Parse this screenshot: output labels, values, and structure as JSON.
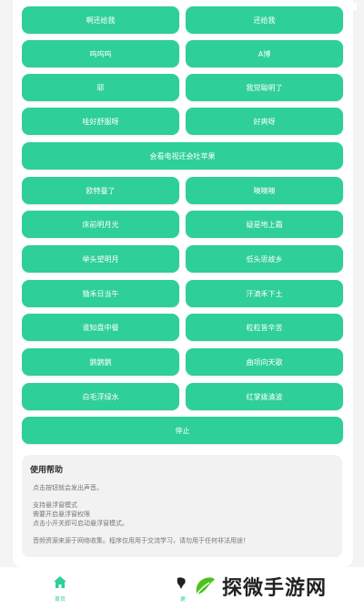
{
  "colors": {
    "accent": "#2ecf98",
    "panel": "#ffffff",
    "background": "#f4f4f4"
  },
  "status_bar": {
    "icons": [
      "signal-icon",
      "battery-icon"
    ]
  },
  "buttons": [
    "啊还给我",
    "还给我",
    "呜呜呜",
    "A博",
    "耶",
    "我觉聪明了",
    "哇好舒服呀",
    "好爽呀",
    "会看电视还会吐苹果",
    "欧特曼了",
    "噢噢噢",
    "床前明月光",
    "疑是地上霜",
    "举头望明月",
    "低头思故乡",
    "锄禾日当午",
    "汗滴禾下土",
    "谁知盘中餐",
    "粒粒皆辛苦",
    "鹅鹅鹅",
    "曲项向天歌",
    "白毛浮绿水",
    "红掌拨清波",
    "停止"
  ],
  "help": {
    "title": "使用帮助",
    "lines": [
      "点击按钮就会发出声音。",
      "支持悬浮窗模式",
      "需要开启悬浮窗权限",
      "点击小开关即可启动悬浮窗模式。",
      "音频资源来源于网络收集。程序仅用用于交流学习，请勿用于任何非法用途！"
    ]
  },
  "nav": {
    "home_label": "首页",
    "second_label": "更"
  },
  "watermark": {
    "text": "探微手游网",
    "icon": "leaf-logo-icon"
  }
}
